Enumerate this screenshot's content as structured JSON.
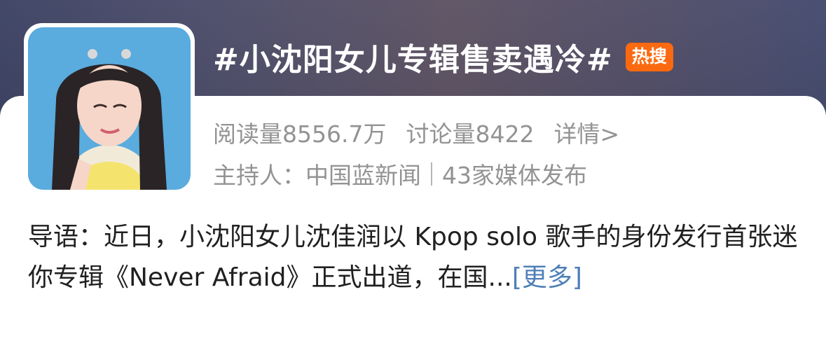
{
  "header": {
    "topic_title": "#小沈阳女儿专辑售卖遇冷#",
    "hot_badge": "热搜"
  },
  "stats": {
    "reads": "阅读量8556.7万",
    "discussions": "讨论量8422",
    "details_link": "详情>"
  },
  "host": {
    "host_label": "主持人：中国蓝新闻",
    "media_count": "43家媒体发布"
  },
  "intro": {
    "text": "导语：近日，小沈阳女儿沈佳润以 Kpop solo 歌手的身份发行首张迷你专辑《Never Afraid》正式出道，在国...",
    "more_link": "[更多]"
  },
  "colors": {
    "hot_badge": "#fb6a10",
    "link": "#4e7fb6",
    "meta_text": "#939393"
  }
}
